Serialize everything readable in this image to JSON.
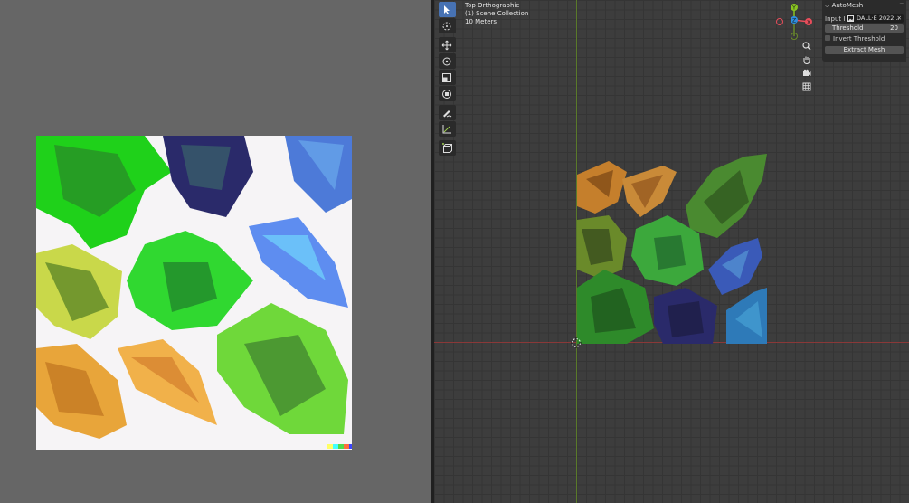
{
  "viewport": {
    "view_name": "Top Orthographic",
    "collection": "(1) Scene Collection",
    "scale": "10 Meters"
  },
  "gizmo": {
    "y_label": "Y",
    "x_label": "X",
    "z_label": "Z"
  },
  "automesh": {
    "header": "AutoMesh",
    "input_label": "Input I...",
    "input_value": "DALL·E 2022...",
    "threshold_label": "Threshold",
    "threshold_value": "20",
    "invert_label": "Invert Threshold",
    "invert_checked": false,
    "extract_label": "Extract Mesh"
  },
  "colors": {
    "accent": "#4772b3",
    "x_axis": "#e84d5b",
    "y_axis": "#8ac521",
    "z_axis": "#2e8fe0"
  },
  "icons": [
    "select-icon",
    "cursor-icon",
    "move-icon",
    "rotate-icon",
    "scale-icon",
    "transform-icon",
    "annotate-icon",
    "measure-icon",
    "add-cube-icon",
    "zoom-icon",
    "pan-hand-icon",
    "camera-icon",
    "grid-icon",
    "image-icon",
    "close-icon"
  ]
}
